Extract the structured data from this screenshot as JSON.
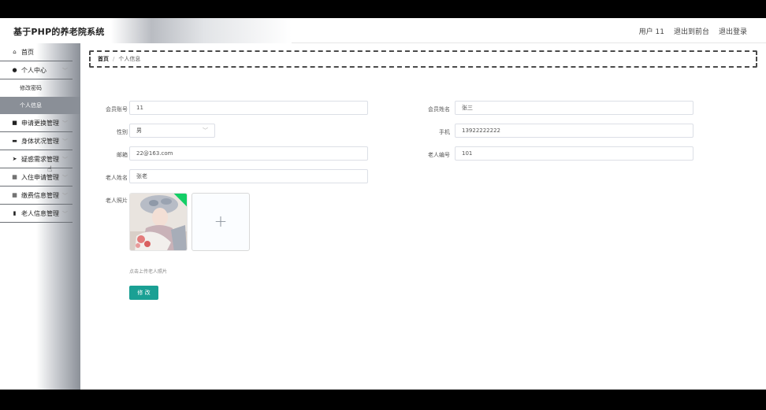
{
  "header": {
    "title": "基于PHP的养老院系统",
    "user_label": "用户 11",
    "front_link": "退出到前台",
    "logout_link": "退出登录"
  },
  "sidebar": {
    "items": [
      {
        "label": "首页",
        "icon": "home-icon",
        "glyph": "⌂"
      },
      {
        "label": "个人中心",
        "icon": "user-icon",
        "glyph": "●"
      },
      {
        "label": "申请更换管理",
        "icon": "video-icon",
        "glyph": "■"
      },
      {
        "label": "身体状况管理",
        "icon": "monitor-icon",
        "glyph": "▬"
      },
      {
        "label": "疑惑需求管理",
        "icon": "send-icon",
        "glyph": "➤"
      },
      {
        "label": "入住申请管理",
        "icon": "grid-icon",
        "glyph": "▦"
      },
      {
        "label": "缴费信息管理",
        "icon": "grid-icon",
        "glyph": "▦"
      },
      {
        "label": "老人信息管理",
        "icon": "bar-chart-icon",
        "glyph": "▮"
      }
    ],
    "sub_items": [
      {
        "label": "修改密码"
      },
      {
        "label": "个人信息"
      }
    ]
  },
  "breadcrumb": {
    "home": "首页",
    "separator": "/",
    "current": "个人信息"
  },
  "form": {
    "account_label": "会员账号",
    "account_value": "11",
    "member_name_label": "会员姓名",
    "member_name_value": "张三",
    "gender_label": "性别",
    "gender_value": "男",
    "phone_label": "手机",
    "phone_value": "13922222222",
    "email_label": "邮箱",
    "email_value": "22@163.com",
    "elder_id_label": "老人编号",
    "elder_id_value": "101",
    "elder_name_label": "老人姓名",
    "elder_name_value": "张老",
    "photo_label": "老人照片",
    "upload_hint": "点击上传老人照片",
    "submit_label": "修 改"
  },
  "colors": {
    "accent": "#1aa094",
    "upload_success": "#13ce66"
  }
}
